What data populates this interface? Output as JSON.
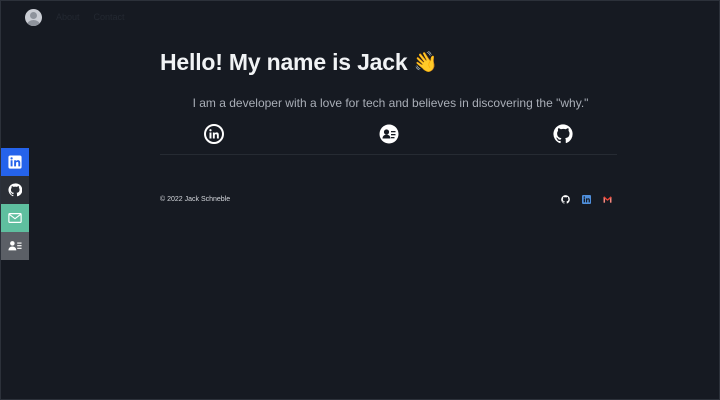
{
  "nav": {
    "links": [
      "About",
      "Contact"
    ]
  },
  "sidebar": {
    "items": [
      {
        "icon": "linkedin-icon",
        "color": "#2563eb"
      },
      {
        "icon": "github-icon",
        "color": "#2b2f36"
      },
      {
        "icon": "mail-icon",
        "color": "#5fbf9f"
      },
      {
        "icon": "resume-icon",
        "color": "#5b5f66"
      }
    ]
  },
  "hero": {
    "title": "Hello! My name is Jack",
    "emoji": "👋",
    "tagline": "I am a developer with a love for tech and believes in discovering the \"why.\""
  },
  "social_icons": [
    "linkedin-icon",
    "resume-icon",
    "github-icon"
  ],
  "footer": {
    "copyright": "© 2022 Jack Schneble",
    "icons": [
      "github-icon",
      "linkedin-icon",
      "gmail-icon"
    ]
  },
  "colors": {
    "background": "#161a22",
    "linkedin": "#2563eb",
    "mail": "#5fbf9f",
    "gmail": "#ea4335"
  }
}
